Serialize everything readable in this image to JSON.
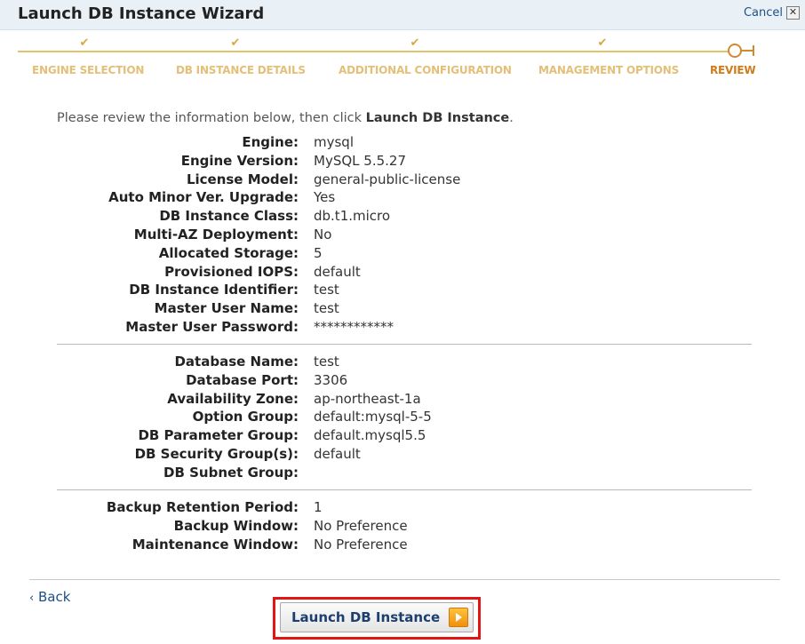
{
  "window": {
    "title": "Launch DB Instance Wizard",
    "cancel_label": "Cancel"
  },
  "steps": [
    {
      "label": "ENGINE SELECTION",
      "state": "done"
    },
    {
      "label": "DB INSTANCE DETAILS",
      "state": "done"
    },
    {
      "label": "ADDITIONAL CONFIGURATION",
      "state": "done"
    },
    {
      "label": "MANAGEMENT OPTIONS",
      "state": "done"
    },
    {
      "label": "REVIEW",
      "state": "current"
    }
  ],
  "intro": {
    "before": "Please review the information below, then click ",
    "action": "Launch DB Instance",
    "after": "."
  },
  "section1": [
    {
      "label": "Engine:",
      "value": "mysql"
    },
    {
      "label": "Engine Version:",
      "value": "MySQL 5.5.27"
    },
    {
      "label": "License Model:",
      "value": "general-public-license"
    },
    {
      "label": "Auto Minor Ver. Upgrade:",
      "value": "Yes"
    },
    {
      "label": "DB Instance Class:",
      "value": "db.t1.micro"
    },
    {
      "label": "Multi-AZ Deployment:",
      "value": "No"
    },
    {
      "label": "Allocated Storage:",
      "value": "5"
    },
    {
      "label": "Provisioned IOPS:",
      "value": "default"
    },
    {
      "label": "DB Instance Identifier:",
      "value": "test"
    },
    {
      "label": "Master User Name:",
      "value": "test"
    },
    {
      "label": "Master User Password:",
      "value": "************"
    }
  ],
  "section2": [
    {
      "label": "Database Name:",
      "value": "test"
    },
    {
      "label": "Database Port:",
      "value": "3306"
    },
    {
      "label": "Availability Zone:",
      "value": "ap-northeast-1a"
    },
    {
      "label": "Option Group:",
      "value": "default:mysql-5-5"
    },
    {
      "label": "DB Parameter Group:",
      "value": "default.mysql5.5"
    },
    {
      "label": "DB Security Group(s):",
      "value": "default"
    },
    {
      "label": "DB Subnet Group:",
      "value": ""
    }
  ],
  "section3": [
    {
      "label": "Backup Retention Period:",
      "value": "1"
    },
    {
      "label": "Backup Window:",
      "value": "No Preference"
    },
    {
      "label": "Maintenance Window:",
      "value": "No Preference"
    }
  ],
  "footer": {
    "back_label": "Back",
    "launch_label": "Launch DB Instance"
  },
  "colors": {
    "accent_orange": "#d17a1a",
    "highlight_red": "#e21414",
    "link_blue": "#1e4f86"
  }
}
